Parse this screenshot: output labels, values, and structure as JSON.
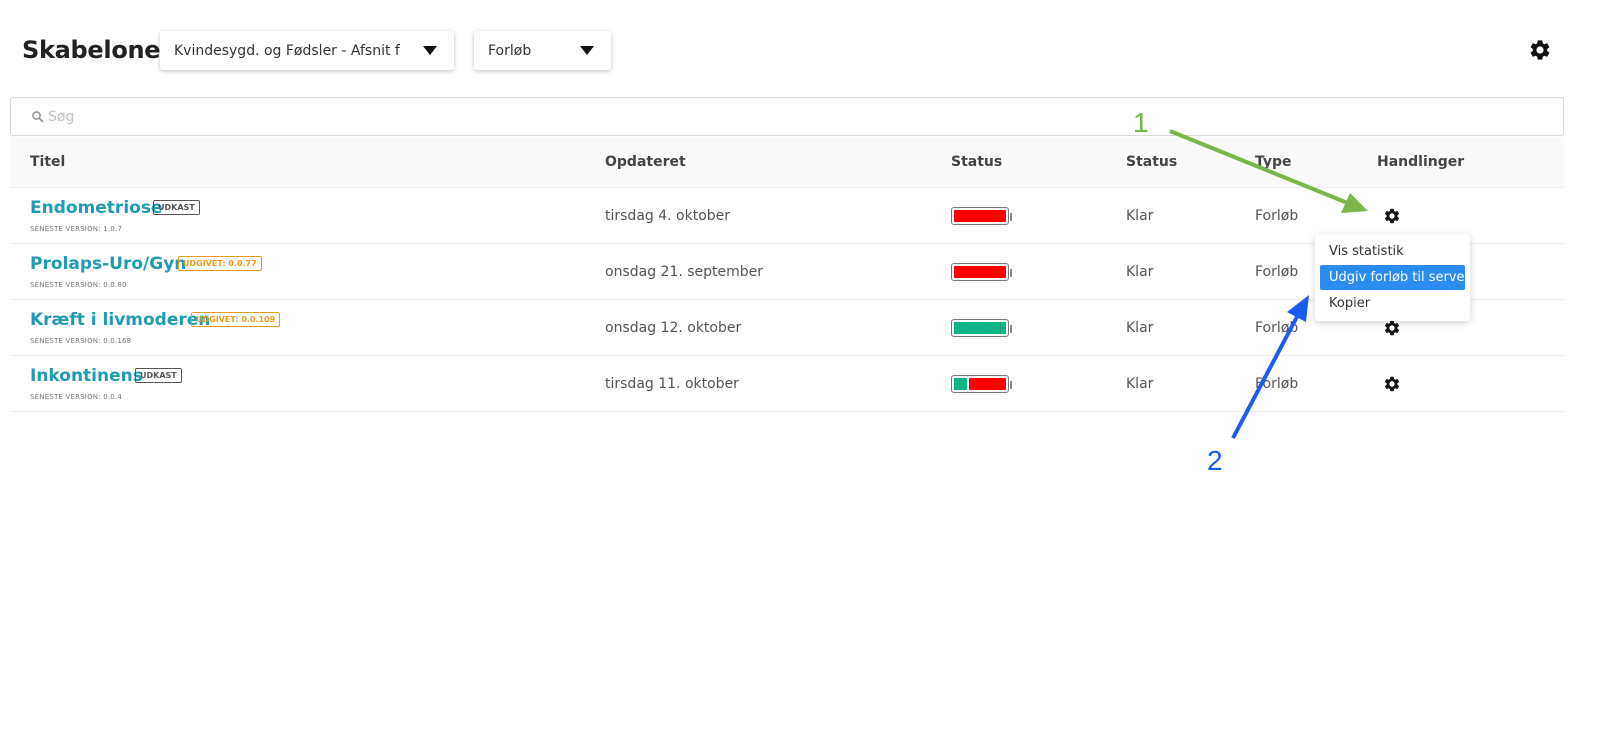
{
  "header": {
    "title": "Skabeloner",
    "department_dropdown": "Kvindesygd. og Fødsler - Afsnit for K...",
    "type_dropdown": "Forløb"
  },
  "search": {
    "placeholder": "Søg",
    "value": ""
  },
  "table": {
    "columns": [
      "Titel",
      "Opdateret",
      "Status",
      "Status",
      "Type",
      "Handlinger"
    ],
    "rows": [
      {
        "title": "Endometriose",
        "badge": "UDKAST",
        "badge_kind": "draft",
        "version": "SENESTE VERSION: 1.0.7",
        "updated": "tirsdag 4. oktober",
        "progress_green": 0,
        "progress_red": 1,
        "status": "Klar",
        "type": "Forløb"
      },
      {
        "title": "Prolaps-Uro/Gyn",
        "badge": "UDGIVET: 0.0.77",
        "badge_kind": "published",
        "version": "SENESTE VERSION: 0.0.80",
        "updated": "onsdag 21. september",
        "progress_green": 0,
        "progress_red": 1,
        "status": "Klar",
        "type": "Forløb"
      },
      {
        "title": "Kræft i livmoderen",
        "badge": "UDGIVET: 0.0.109",
        "badge_kind": "published",
        "version": "SENESTE VERSION: 0.0.168",
        "updated": "onsdag 12. oktober",
        "progress_green": 1,
        "progress_red": 0,
        "status": "Klar",
        "type": "Forløb"
      },
      {
        "title": "Inkontinens",
        "badge": "UDKAST",
        "badge_kind": "draft",
        "version": "SENESTE VERSION: 0.0.4",
        "updated": "tirsdag 11. oktober",
        "progress_green": 0.25,
        "progress_red": 0.75,
        "status": "Klar",
        "type": "Forløb"
      }
    ]
  },
  "context_menu": {
    "items": [
      "Vis statistik",
      "Udgiv forløb til server",
      "Kopier"
    ],
    "active_index": 1
  },
  "annotations": [
    {
      "label": "1",
      "color": "#7ab648"
    },
    {
      "label": "2",
      "color": "#1a5cf0"
    }
  ],
  "colors": {
    "link": "#1e9bb6",
    "progress_red": "#ff0000",
    "progress_green": "#0fb485",
    "menu_active": "#2b8df2"
  },
  "icons": {
    "settings": "gear-icon",
    "search": "search-icon",
    "caret": "caret-down-icon"
  }
}
